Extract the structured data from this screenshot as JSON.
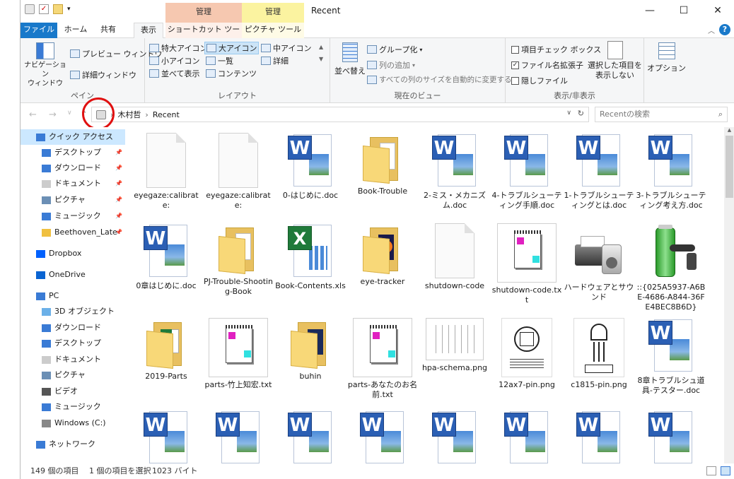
{
  "window": {
    "title": "Recent"
  },
  "context_tabs": {
    "manage1": "管理",
    "manage2": "管理"
  },
  "tabs": {
    "file": "ファイル",
    "home": "ホーム",
    "share": "共有",
    "view": "表示",
    "shortcut": "ショートカット ツール",
    "picture": "ピクチャ ツール"
  },
  "ribbon": {
    "pane": {
      "nav_pane": "ナビゲーション\nウィンドウ",
      "preview": "プレビュー ウィンドウ",
      "details": "詳細ウィンドウ",
      "label": "ペイン"
    },
    "layout": {
      "xl": "特大アイコン",
      "large": "大アイコン",
      "medium": "中アイコン",
      "small": "小アイコン",
      "list": "一覧",
      "detail": "詳細",
      "tiles": "並べて表示",
      "content": "コンテンツ",
      "label": "レイアウト"
    },
    "current_view": {
      "sort": "並べ替え",
      "group": "グループ化",
      "add_col": "列の追加",
      "fit_cols": "すべての列のサイズを自動的に変更する",
      "label": "現在のビュー"
    },
    "show_hide": {
      "item_check": "項目チェック ボックス",
      "file_ext": "ファイル名拡張子",
      "hidden": "隠しファイル",
      "hide_selected": "選択した項目を\n表示しない",
      "label": "表示/非表示"
    },
    "options": "オプション"
  },
  "address": {
    "path1": "木村哲",
    "path2": "Recent",
    "search_placeholder": "Recentの検索"
  },
  "nav": [
    {
      "label": "クイック アクセス"
    },
    {
      "label": "デスクトップ"
    },
    {
      "label": "ダウンロード"
    },
    {
      "label": "ドキュメント"
    },
    {
      "label": "ピクチャ"
    },
    {
      "label": "ミュージック"
    },
    {
      "label": "Beethoven_Late"
    },
    {
      "label": "Dropbox"
    },
    {
      "label": "OneDrive"
    },
    {
      "label": "PC"
    },
    {
      "label": "3D オブジェクト"
    },
    {
      "label": "ダウンロード"
    },
    {
      "label": "デスクトップ"
    },
    {
      "label": "ドキュメント"
    },
    {
      "label": "ピクチャ"
    },
    {
      "label": "ビデオ"
    },
    {
      "label": "ミュージック"
    },
    {
      "label": "Windows (C:)"
    },
    {
      "label": "ネットワーク"
    }
  ],
  "files": [
    {
      "name": "eyegaze:calibrate:",
      "kind": "blank"
    },
    {
      "name": "eyegaze:calibrate:",
      "kind": "blank"
    },
    {
      "name": "0-はじめに.doc",
      "kind": "word"
    },
    {
      "name": "Book-Trouble",
      "kind": "folder"
    },
    {
      "name": "2-ミス・メカニズム.doc",
      "kind": "word"
    },
    {
      "name": "4-トラブルシューティング手順.doc",
      "kind": "word"
    },
    {
      "name": "1-トラブルシューティングとは.doc",
      "kind": "word"
    },
    {
      "name": "3-トラブルシューティング考え方.doc",
      "kind": "word"
    },
    {
      "name": "0章はじめに.doc",
      "kind": "word"
    },
    {
      "name": "PJ-Trouble-Shooting-Book",
      "kind": "folder"
    },
    {
      "name": "Book-Contents.xls",
      "kind": "excel"
    },
    {
      "name": "eye-tracker",
      "kind": "folderff"
    },
    {
      "name": "shutdown-code",
      "kind": "blank"
    },
    {
      "name": "shutdown-code.txt",
      "kind": "note"
    },
    {
      "name": "ハードウェアとサウンド",
      "kind": "printer"
    },
    {
      "name": "::{025A5937-A6BE-4686-A844-36FE4BEC8B6D}",
      "kind": "battery"
    },
    {
      "name": "2019-Parts",
      "kind": "folderxl"
    },
    {
      "name": "parts-竹上知宏.txt",
      "kind": "note"
    },
    {
      "name": "buhin",
      "kind": "folderdoc"
    },
    {
      "name": "parts-あなたのお名前.txt",
      "kind": "note"
    },
    {
      "name": "hpa-schema.png",
      "kind": "schema"
    },
    {
      "name": "12ax7-pin.png",
      "kind": "pin"
    },
    {
      "name": "c1815-pin.png",
      "kind": "pin2"
    },
    {
      "name": "8章トラブルシュ道具-テスター.doc",
      "kind": "word"
    },
    {
      "name": "",
      "kind": "word"
    },
    {
      "name": "",
      "kind": "word"
    },
    {
      "name": "",
      "kind": "word"
    },
    {
      "name": "",
      "kind": "word"
    },
    {
      "name": "",
      "kind": "word"
    },
    {
      "name": "",
      "kind": "word"
    },
    {
      "name": "",
      "kind": "word"
    },
    {
      "name": "",
      "kind": "word"
    }
  ],
  "status": {
    "count": "149 個の項目",
    "selected": "1 個の項目を選択",
    "size": "1023 バイト"
  }
}
